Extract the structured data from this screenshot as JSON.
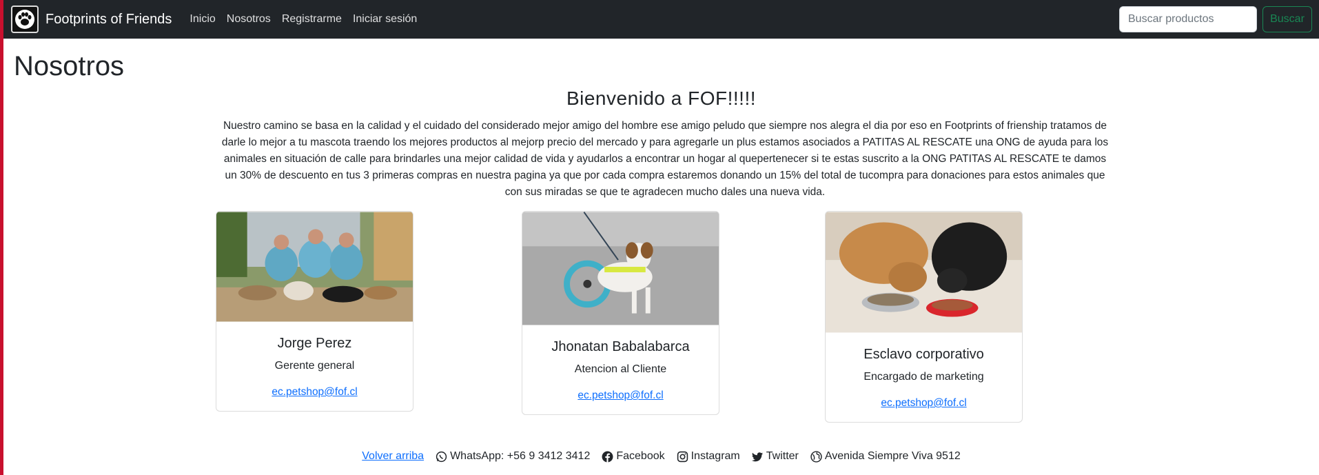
{
  "navbar": {
    "brand": "Footprints of Friends",
    "links": [
      "Inicio",
      "Nosotros",
      "Registrarme",
      "Iniciar sesión"
    ],
    "search_placeholder": "Buscar productos",
    "search_button": "Buscar"
  },
  "page": {
    "title": "Nosotros",
    "welcome": "Bienvenido a FOF!!!!!",
    "intro": "Nuestro camino se basa en la calidad y el cuidado del considerado mejor amigo del hombre ese amigo peludo que siempre nos alegra el dia por eso en Footprints of frienship tratamos de darle lo mejor a tu mascota traendo los mejores productos al mejorp precio del mercado y para agregarle un plus estamos asociados a PATITAS AL RESCATE una ONG de ayuda para los animales en situación de calle para brindarles una mejor calidad de vida y ayudarlos a encontrar un hogar al quepertenecer si te estas suscrito a la ONG PATITAS AL RESCATE te damos un 30% de descuento en tus 3 primeras compras en nuestra pagina ya que por cada compra estaremos donando un 15% del total de tucompra para donaciones para estos animales que con sus miradas se que te agradecen mucho dales una nueva vida."
  },
  "team": [
    {
      "name": "Jorge Perez",
      "role": "Gerente general",
      "email": "ec.petshop@fof.cl"
    },
    {
      "name": "Jhonatan Babalabarca",
      "role": "Atencion al Cliente",
      "email": "ec.petshop@fof.cl"
    },
    {
      "name": "Esclavo corporativo",
      "role": "Encargado de marketing",
      "email": "ec.petshop@fof.cl"
    }
  ],
  "footer": {
    "back_to_top": "Volver arriba",
    "whatsapp": "WhatsApp: +56 9 3412 3412",
    "facebook": "Facebook",
    "instagram": "Instagram",
    "twitter": "Twitter",
    "address": "Avenida Siempre Viva 9512"
  },
  "colors": {
    "navbar": "#212529",
    "accent_green": "#198754",
    "link_blue": "#0d6efd",
    "left_border": "#c8102e"
  }
}
